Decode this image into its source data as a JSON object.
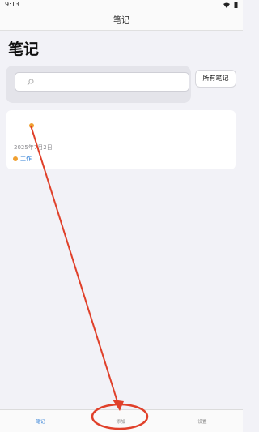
{
  "status_bar": {
    "time": "9:13"
  },
  "header": {
    "title": "笔记"
  },
  "page": {
    "title": "笔记"
  },
  "search": {
    "placeholder": ""
  },
  "actions": {
    "all_notes_label": "所有笔记"
  },
  "notes": [
    {
      "date": "2025年7月2日",
      "tag": "工作",
      "tag_color": "#f0a030"
    }
  ],
  "tab_bar": {
    "items": [
      {
        "label": "笔记",
        "active": true
      },
      {
        "label": "添加",
        "active": false
      },
      {
        "label": "设置",
        "active": false
      }
    ]
  },
  "colors": {
    "accent": "#2f7fd6",
    "tag": "#f0a030",
    "annotation": "#e0402a"
  }
}
